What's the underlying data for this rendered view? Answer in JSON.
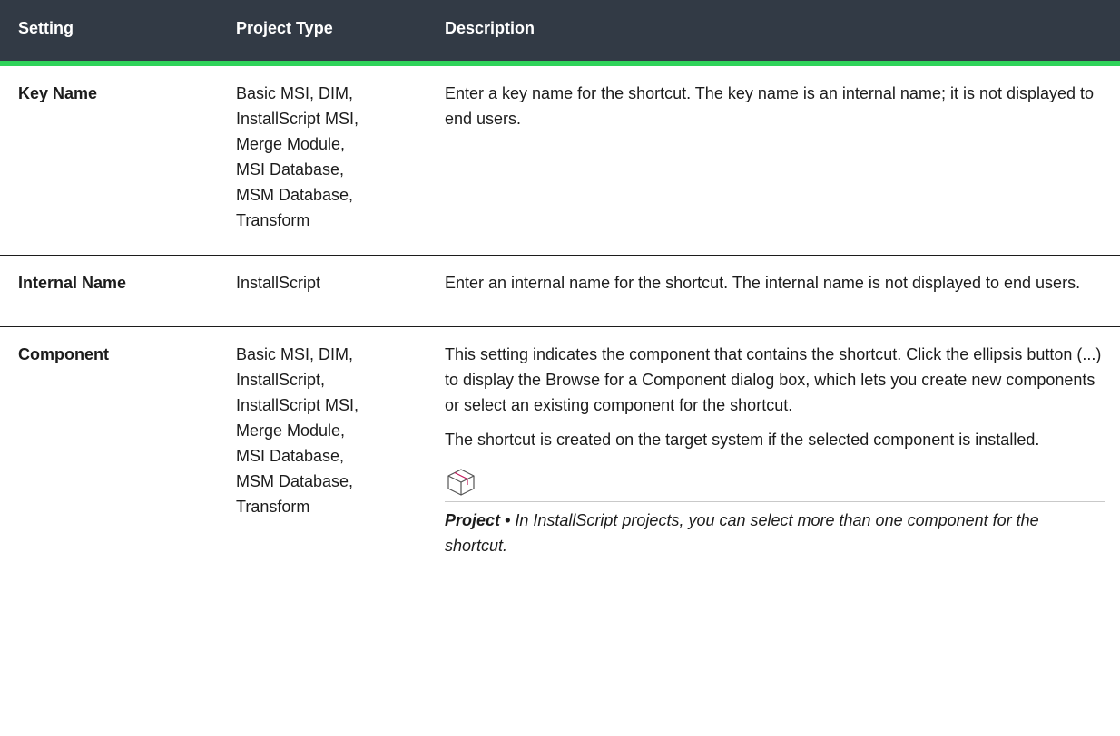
{
  "columns": {
    "setting": "Setting",
    "project_type": "Project Type",
    "description": "Description"
  },
  "rows": [
    {
      "setting": "Key Name",
      "project_type": "Basic MSI, DIM,\nInstallScript MSI,\nMerge Module,\nMSI Database,\nMSM Database,\nTransform",
      "description": [
        "Enter a key name for the shortcut. The key name is an internal name; it is not displayed to end users."
      ]
    },
    {
      "setting": "Internal Name",
      "project_type": "InstallScript",
      "description": [
        "Enter an internal name for the shortcut. The internal name is not displayed to end users."
      ]
    },
    {
      "setting": "Component",
      "project_type": "Basic MSI, DIM,\nInstallScript,\nInstallScript MSI,\nMerge Module,\nMSI Database,\nMSM Database,\nTransform",
      "description": [
        "This setting indicates the component that contains the shortcut. Click the ellipsis button (...) to display the Browse for a Component dialog box, which lets you create new components or select an existing component for the shortcut.",
        "The shortcut is created on the target system if the selected component is installed."
      ],
      "note": {
        "icon": "project-box-icon",
        "label": "Project",
        "separator": "•",
        "text": "In InstallScript projects, you can select more than one component for the shortcut."
      }
    }
  ],
  "colors": {
    "header_bg": "#323a45",
    "header_accent": "#2fd35a",
    "icon_accent": "#c2185b"
  }
}
